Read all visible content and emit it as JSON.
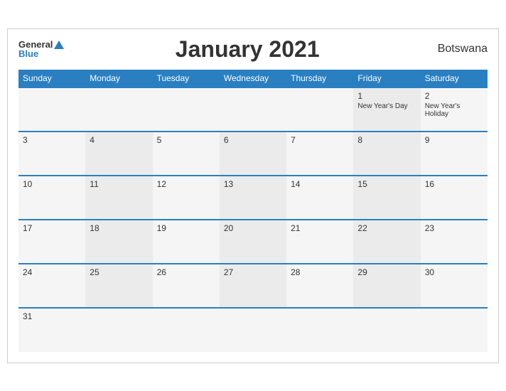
{
  "header": {
    "logo_general": "General",
    "logo_blue": "Blue",
    "title": "January 2021",
    "country": "Botswana"
  },
  "days_of_week": [
    "Sunday",
    "Monday",
    "Tuesday",
    "Wednesday",
    "Thursday",
    "Friday",
    "Saturday"
  ],
  "weeks": [
    [
      {
        "day": "",
        "holiday": ""
      },
      {
        "day": "",
        "holiday": ""
      },
      {
        "day": "",
        "holiday": ""
      },
      {
        "day": "",
        "holiday": ""
      },
      {
        "day": "",
        "holiday": ""
      },
      {
        "day": "1",
        "holiday": "New Year's Day"
      },
      {
        "day": "2",
        "holiday": "New Year's Holiday"
      }
    ],
    [
      {
        "day": "3",
        "holiday": ""
      },
      {
        "day": "4",
        "holiday": ""
      },
      {
        "day": "5",
        "holiday": ""
      },
      {
        "day": "6",
        "holiday": ""
      },
      {
        "day": "7",
        "holiday": ""
      },
      {
        "day": "8",
        "holiday": ""
      },
      {
        "day": "9",
        "holiday": ""
      }
    ],
    [
      {
        "day": "10",
        "holiday": ""
      },
      {
        "day": "11",
        "holiday": ""
      },
      {
        "day": "12",
        "holiday": ""
      },
      {
        "day": "13",
        "holiday": ""
      },
      {
        "day": "14",
        "holiday": ""
      },
      {
        "day": "15",
        "holiday": ""
      },
      {
        "day": "16",
        "holiday": ""
      }
    ],
    [
      {
        "day": "17",
        "holiday": ""
      },
      {
        "day": "18",
        "holiday": ""
      },
      {
        "day": "19",
        "holiday": ""
      },
      {
        "day": "20",
        "holiday": ""
      },
      {
        "day": "21",
        "holiday": ""
      },
      {
        "day": "22",
        "holiday": ""
      },
      {
        "day": "23",
        "holiday": ""
      }
    ],
    [
      {
        "day": "24",
        "holiday": ""
      },
      {
        "day": "25",
        "holiday": ""
      },
      {
        "day": "26",
        "holiday": ""
      },
      {
        "day": "27",
        "holiday": ""
      },
      {
        "day": "28",
        "holiday": ""
      },
      {
        "day": "29",
        "holiday": ""
      },
      {
        "day": "30",
        "holiday": ""
      }
    ],
    [
      {
        "day": "31",
        "holiday": ""
      },
      {
        "day": "",
        "holiday": ""
      },
      {
        "day": "",
        "holiday": ""
      },
      {
        "day": "",
        "holiday": ""
      },
      {
        "day": "",
        "holiday": ""
      },
      {
        "day": "",
        "holiday": ""
      },
      {
        "day": "",
        "holiday": ""
      }
    ]
  ]
}
